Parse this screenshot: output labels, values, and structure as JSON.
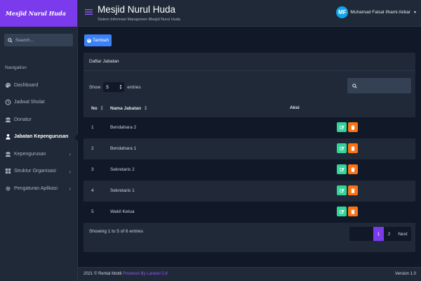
{
  "brand": {
    "logo_text": "Mesjid Nurul Huda"
  },
  "sidebar": {
    "search_placeholder": "Search...",
    "heading": "Navigation",
    "items": [
      {
        "label": "Dashboard",
        "icon": "palette-icon"
      },
      {
        "label": "Jadwal Sholat",
        "icon": "clock-icon"
      },
      {
        "label": "Donatur",
        "icon": "users-icon"
      },
      {
        "label": "Jabatan Kepengurusan",
        "icon": "user-icon",
        "active": true
      },
      {
        "label": "Kepengurusan",
        "icon": "users-icon"
      },
      {
        "label": "Struktur Organisasi",
        "icon": "grid-icon"
      },
      {
        "label": "Pengaturan Aplikasi",
        "icon": "gear-icon"
      }
    ]
  },
  "header": {
    "title": "Mesjid Nurul Huda",
    "subtitle": "Sistem Informasi Manajemen Mesjid Nurul Huda",
    "user_initials": "MF",
    "user_name": "Muhamad Faisal Ilhami Akbar"
  },
  "main": {
    "add_button": "Tambah",
    "card_title": "Daftar Jabatan",
    "show_label": "Show",
    "entries_value": "5",
    "entries_label": "entries",
    "columns": [
      "No",
      "Nama Jabatan",
      "Aksi"
    ],
    "rows": [
      {
        "no": "1",
        "nama": "Bendahara 2"
      },
      {
        "no": "2",
        "nama": "Bendahara 1"
      },
      {
        "no": "3",
        "nama": "Sekretaris 2"
      },
      {
        "no": "4",
        "nama": "Sekretaris 1"
      },
      {
        "no": "5",
        "nama": "Wakil Ketua"
      }
    ],
    "info": "Showing 1 to 5 of 6 entries",
    "pagination": {
      "page1": "1",
      "page2": "2",
      "next": "Next"
    }
  },
  "footer": {
    "copyright": "2021 © Rental Mobil",
    "powered": "Powered By Laravel 5.8",
    "version": "Version 1.0"
  },
  "colors": {
    "brand": "#7c3aed",
    "primary": "#3b82f6",
    "edit": "#34d399",
    "delete": "#f97316"
  }
}
